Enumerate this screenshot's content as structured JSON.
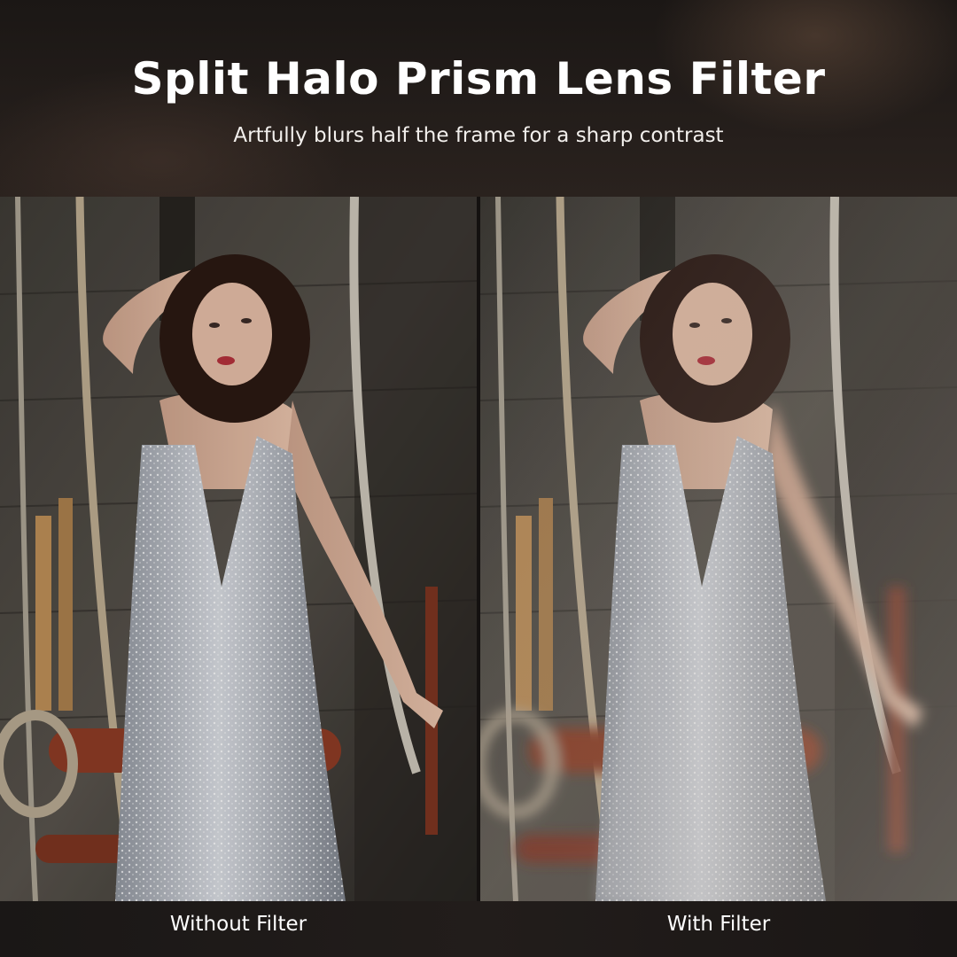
{
  "banner": {
    "title": "Split Halo Prism Lens Filter",
    "subtitle": "Artfully blurs half the frame for a sharp contrast"
  },
  "comparison": {
    "left_caption": "Without Filter",
    "right_caption": "With Filter"
  },
  "colors": {
    "background": "#141110",
    "text": "#ffffff",
    "dress": "#b9bcc4",
    "wall": "#4a4640",
    "pipe": "#8a3a24"
  }
}
